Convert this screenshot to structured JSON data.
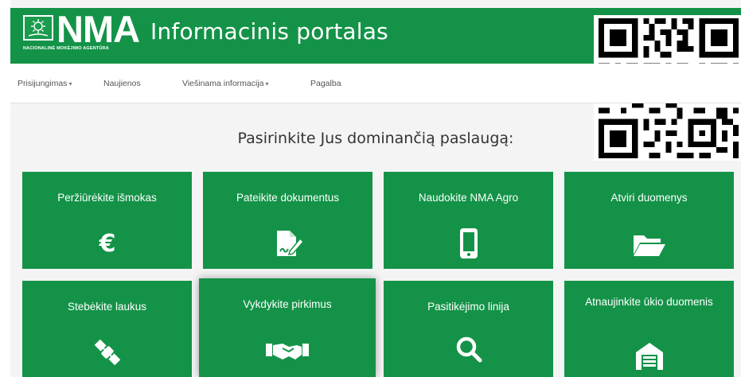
{
  "header": {
    "logo_text": "NMA",
    "logo_subtitle": "NACIONALINĖ MOKĖJIMO AGENTŪRA",
    "title": "Informacinis portalas"
  },
  "nav": {
    "items": [
      {
        "label": "Prisijungimas",
        "dropdown": true
      },
      {
        "label": "Naujienos",
        "dropdown": false
      },
      {
        "label": "Viešinama informacija",
        "dropdown": true
      },
      {
        "label": "Pagalba",
        "dropdown": false
      }
    ]
  },
  "main": {
    "heading": "Pasirinkite Jus dominančią paslaugą:",
    "tiles": [
      {
        "label": "Peržiūrėkite išmokas",
        "icon": "euro-icon"
      },
      {
        "label": "Pateikite dokumentus",
        "icon": "document-edit-icon"
      },
      {
        "label": "Naudokite NMA Agro",
        "icon": "mobile-phone-icon"
      },
      {
        "label": "Atviri duomenys",
        "icon": "folder-open-icon"
      },
      {
        "label": "Stebėkite laukus",
        "icon": "satellite-icon"
      },
      {
        "label": "Vykdykite pirkimus",
        "icon": "handshake-icon"
      },
      {
        "label": "Pasitikėjimo linija",
        "icon": "search-icon"
      },
      {
        "label": "Atnaujinkite ūkio duomenis",
        "icon": "warehouse-icon"
      }
    ]
  },
  "colors": {
    "brand_green": "#149348",
    "background": "#f4f4f4"
  }
}
